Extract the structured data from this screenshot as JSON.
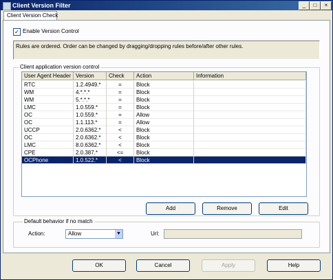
{
  "window": {
    "title": "Client Version Filter",
    "controls": {
      "minimize": "_",
      "maximize": "□",
      "close": "×"
    }
  },
  "tab": {
    "label": "Client Version Check"
  },
  "enable": {
    "label": "Enable Version Control",
    "checked": true,
    "mark": "✓"
  },
  "info_text": "Rules are ordered. Order can be changed by dragging/dropping rules before/after other rules.",
  "client_group": {
    "legend": "Client application version control"
  },
  "columns": [
    "User Agent Header",
    "Version",
    "Check",
    "Action",
    "Information"
  ],
  "rows": [
    {
      "agent": "RTC",
      "version": "1.2.4949.*",
      "check": "=",
      "action": "Block",
      "info": ""
    },
    {
      "agent": "WM",
      "version": "4.*.*.*",
      "check": "=",
      "action": "Block",
      "info": ""
    },
    {
      "agent": "WM",
      "version": "5.*.*.*",
      "check": "=",
      "action": "Block",
      "info": ""
    },
    {
      "agent": "LMC",
      "version": "1.0.559.*",
      "check": "=",
      "action": "Block",
      "info": ""
    },
    {
      "agent": "OC",
      "version": "1.0.559.*",
      "check": "=",
      "action": "Allow",
      "info": ""
    },
    {
      "agent": "OC",
      "version": "1.1.113.*",
      "check": "=",
      "action": "Allow",
      "info": ""
    },
    {
      "agent": "UCCP",
      "version": "2.0.6362.*",
      "check": "<",
      "action": "Block",
      "info": ""
    },
    {
      "agent": "OC",
      "version": "2.0.6362.*",
      "check": "<",
      "action": "Block",
      "info": ""
    },
    {
      "agent": "LMC",
      "version": "8.0.6362.*",
      "check": "<",
      "action": "Block",
      "info": ""
    },
    {
      "agent": "CPE",
      "version": "2.0.387.*",
      "check": "<=",
      "action": "Block",
      "info": ""
    },
    {
      "agent": "OCPhone",
      "version": "1.0.522.*",
      "check": "<",
      "action": "Block",
      "info": "",
      "selected": true
    }
  ],
  "buttons": {
    "add": "Add",
    "remove": "Remove",
    "edit": "Edit"
  },
  "default_group": {
    "legend": "Default behavior if no match"
  },
  "action_label": "Action:",
  "action_value": "Allow",
  "url_label": "Url:",
  "footer": {
    "ok": "OK",
    "cancel": "Cancel",
    "apply": "Apply",
    "help": "Help"
  }
}
